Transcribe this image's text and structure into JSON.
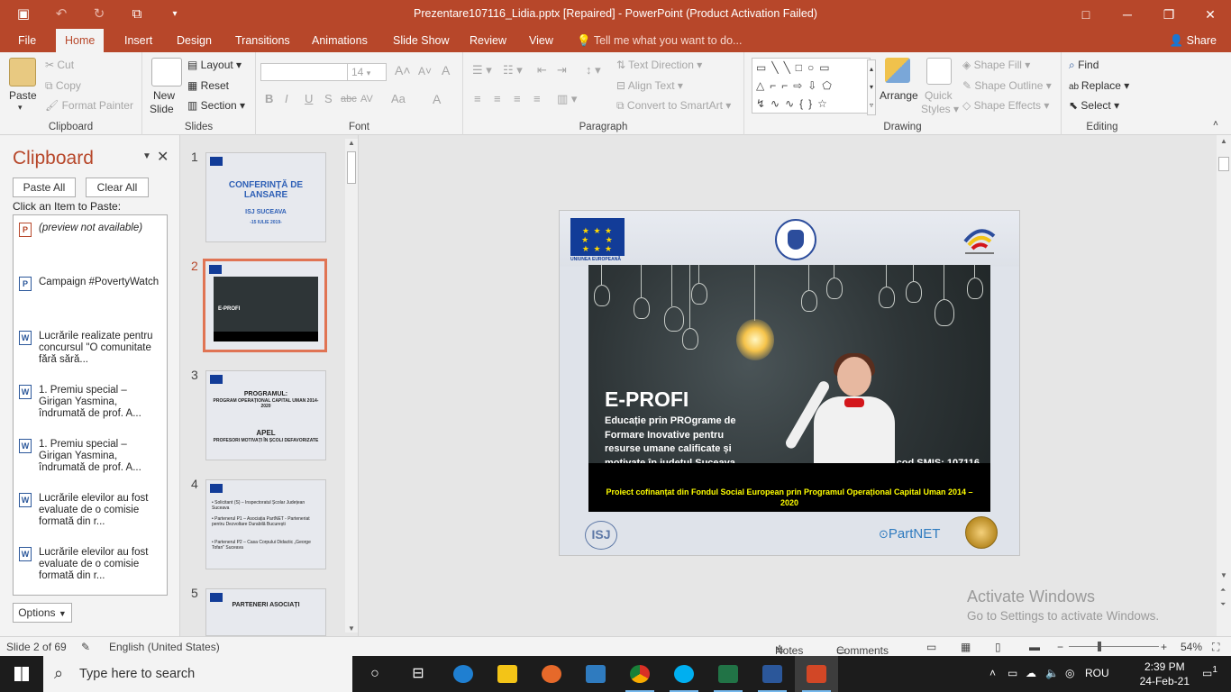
{
  "app": {
    "title": "Prezentare107116_Lidia.pptx [Repaired] - PowerPoint (Product Activation Failed)",
    "accent": "#b7472a"
  },
  "qat": {
    "save": "save-icon",
    "undo": "undo-icon",
    "redo": "redo-icon",
    "present": "start-presentation-icon",
    "customize": "customize-qat-icon"
  },
  "window_controls": {
    "ribbon_display": "□",
    "minimize": "─",
    "restore": "❐",
    "close": "✕"
  },
  "tabs": [
    "File",
    "Home",
    "Insert",
    "Design",
    "Transitions",
    "Animations",
    "Slide Show",
    "Review",
    "View"
  ],
  "active_tab": "Home",
  "tell_me": "Tell me what you want to do...",
  "share": "Share",
  "ribbon": {
    "clipboard": {
      "label": "Clipboard",
      "paste": "Paste",
      "cut": "Cut",
      "copy": "Copy",
      "format_painter": "Format Painter"
    },
    "slides": {
      "label": "Slides",
      "new_slide": "New",
      "new_slide2": "Slide",
      "layout": "Layout",
      "reset": "Reset",
      "section": "Section"
    },
    "font": {
      "label": "Font",
      "font_name": "",
      "font_size": "14",
      "bold": "B",
      "italic": "I",
      "underline": "U",
      "shadow": "S",
      "strike": "abc",
      "spacing": "AV",
      "case": "Aa",
      "color": "A",
      "grow": "A",
      "shrink": "A",
      "clear": "A"
    },
    "paragraph": {
      "label": "Paragraph",
      "text_direction": "Text Direction",
      "align_text": "Align Text",
      "smartart": "Convert to SmartArt"
    },
    "drawing": {
      "label": "Drawing",
      "arrange": "Arrange",
      "quick_styles": "Quick",
      "quick_styles2": "Styles",
      "shape_fill": "Shape Fill",
      "shape_outline": "Shape Outline",
      "shape_effects": "Shape Effects"
    },
    "editing": {
      "label": "Editing",
      "find": "Find",
      "replace": "Replace",
      "select": "Select"
    }
  },
  "clipboard_pane": {
    "title": "Clipboard",
    "paste_all": "Paste All",
    "clear_all": "Clear All",
    "hint": "Click an Item to Paste:",
    "options": "Options",
    "items": [
      {
        "type": "ppt",
        "text": "(preview not available)"
      },
      {
        "type": "ppt",
        "text": "Campaign #PovertyWatch"
      },
      {
        "type": "word",
        "text": "Lucrările realizate pentru concursul \"O comunitate fără sără..."
      },
      {
        "type": "word",
        "text": "1. Premiu special – Girigan Yasmina, îndrumată de prof. A..."
      },
      {
        "type": "word",
        "text": "1. Premiu special – Girigan Yasmina, îndrumată de prof. A..."
      },
      {
        "type": "word",
        "text": "Lucrările elevilor au fost evaluate de o comisie formată din r..."
      },
      {
        "type": "word",
        "text": "Lucrările elevilor au fost evaluate de o comisie formată din r..."
      }
    ]
  },
  "thumbnails": [
    {
      "num": "1",
      "title": "CONFERINȚĂ DE LANSARE",
      "sub": "ISJ SUCEAVA",
      "sub2": "-15 IULIE 2019-"
    },
    {
      "num": "2",
      "title": "E-PROFI",
      "selected": true
    },
    {
      "num": "3",
      "title": "PROGRAMUL:",
      "sub": "PROGRAM OPERAȚIONAL CAPITAL UMAN 2014-2020",
      "sub2": "APEL",
      "sub3": "PROFESORI MOTIVAȚI ÎN ȘCOLI DEFAVORIZATE"
    },
    {
      "num": "4",
      "line1": "• Solicitant (S) – Inspectoratul Școlar Județean Suceava",
      "line2": "• Partenerul P1 – Asociația PartNET - Parteneriat pentru Dezvoltare Durabilă București",
      "line3": "• Partenerul P2 – Casa Corpului Didactic „George Tofan\" Suceava"
    },
    {
      "num": "5",
      "title": "PARTENERI ASOCIAȚI"
    }
  ],
  "slide": {
    "eu_label": "UNIUNEA EUROPEANĂ",
    "title": "E-PROFI",
    "subtitle": "Educație prin PROgrame de Formare Inovative pentru resurse umane calificate și motivate în județul Suceava",
    "smis": "cod SMIS: 107116",
    "footer": "Proiect cofinanțat din Fondul Social European prin Programul Operațional Capital Uman 2014 – 2020",
    "isj": "ISJ",
    "partnet": "PartNET"
  },
  "activate": {
    "line1": "Activate Windows",
    "line2": "Go to Settings to activate Windows."
  },
  "status": {
    "slide_info": "Slide 2 of 69",
    "language": "English (United States)",
    "notes": "Notes",
    "comments": "Comments",
    "zoom": "54%",
    "zoom_fraction": 0.34
  },
  "taskbar": {
    "search": "Type here to search",
    "lang": "ROU",
    "time": "2:39 PM",
    "date": "24-Feb-21",
    "notifications": "1"
  }
}
